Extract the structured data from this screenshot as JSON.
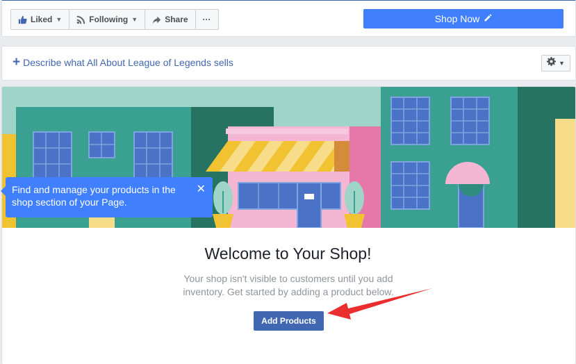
{
  "header_actions": {
    "liked_label": "Liked",
    "following_label": "Following",
    "share_label": "Share",
    "more_label": "···",
    "shop_now_label": "Shop Now"
  },
  "description": {
    "plus": "+",
    "link_text": "Describe what All About League of Legends sells"
  },
  "tooltip": {
    "text": "Find and manage your products in the shop section of your Page.",
    "close": "✕"
  },
  "shop": {
    "title": "Welcome to Your Shop!",
    "subtitle": "Your shop isn't visible to customers until you add inventory. Get started by adding a product below.",
    "add_button": "Add Products"
  },
  "colors": {
    "brand_blue": "#4267b2",
    "accent_blue": "#4080ff",
    "annotation_red": "#ea2d2d"
  }
}
